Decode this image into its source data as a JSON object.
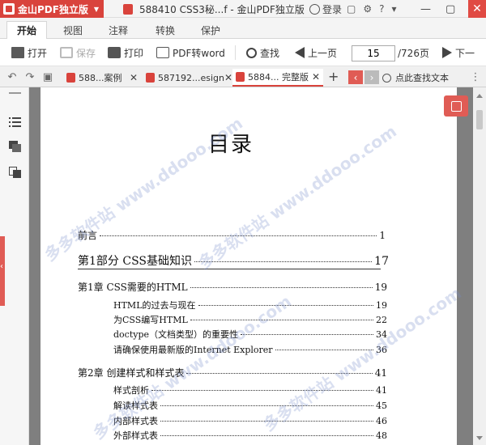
{
  "titlebar": {
    "app_name": "金山PDF独立版",
    "doc_title": "588410 CSS3秘...f - 金山PDF独立版",
    "login": "登录",
    "help": "?"
  },
  "ribbon": {
    "tabs": [
      "开始",
      "视图",
      "注释",
      "转换",
      "保护"
    ],
    "active_tab": "开始"
  },
  "toolbar": {
    "open": "打开",
    "save": "保存",
    "print": "打印",
    "pdf_to_word": "PDF转word",
    "find": "查找",
    "prev_page": "上一页",
    "next_page": "下一",
    "current_page": "15",
    "total_pages": "/726页"
  },
  "doc_tabs": [
    {
      "label": "588...案例"
    },
    {
      "label": "587192...esign"
    },
    {
      "label": "5884... 完整版"
    }
  ],
  "find_text": "点此查找文本",
  "document": {
    "title": "目录",
    "toc": [
      {
        "text": "前言",
        "page": "1"
      },
      {
        "text": "第1部分  CSS基础知识",
        "page": "17"
      },
      {
        "text": "第1章  CSS需要的HTML",
        "page": "19"
      },
      {
        "text": "HTML的过去与现在",
        "page": "19"
      },
      {
        "text": "为CSS编写HTML",
        "page": "22"
      },
      {
        "text": "doctype（文档类型）的重要性",
        "page": "34"
      },
      {
        "text": "请确保使用最新版的Internet Explorer",
        "page": "36"
      },
      {
        "text": "第2章  创建样式和样式表",
        "page": "41"
      },
      {
        "text": "样式剖析",
        "page": "41"
      },
      {
        "text": "解读样式表",
        "page": "45"
      },
      {
        "text": "内部样式表",
        "page": "46"
      },
      {
        "text": "外部样式表",
        "page": "48"
      }
    ]
  },
  "watermark": "多多软件站  www.ddooo.com",
  "colors": {
    "accent": "#d9433c",
    "viewer_bg": "#7f7f7f"
  }
}
